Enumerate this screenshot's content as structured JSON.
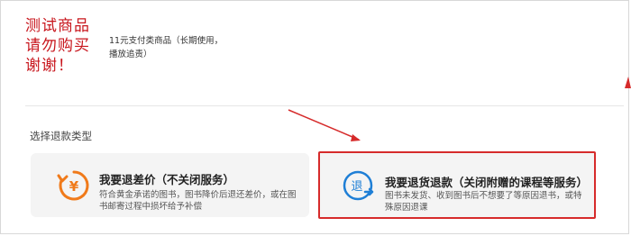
{
  "product": {
    "thumb_lines": [
      "测试商品",
      "请勿购买",
      "谢谢！"
    ],
    "description": "11元支付类商品（长期使用，播放追责）"
  },
  "refund": {
    "section_title": "选择退款类型",
    "options": [
      {
        "title": "我要退差价（不关闭服务）",
        "desc": "符合黄金承诺的图书，图书降价后退还差价，或在图书邮寄过程中损坏给予补偿",
        "icon": "yen-refresh-icon",
        "icon_color": "#f07a1a"
      },
      {
        "title": "我要退货退款（关闭附赠的课程等服务）",
        "desc": "图书未发货、收到图书后不想要了等原因退书，或特殊原因退课",
        "icon": "return-icon",
        "icon_color": "#1f7fd6",
        "highlight_color": "#d62b2b"
      }
    ]
  }
}
